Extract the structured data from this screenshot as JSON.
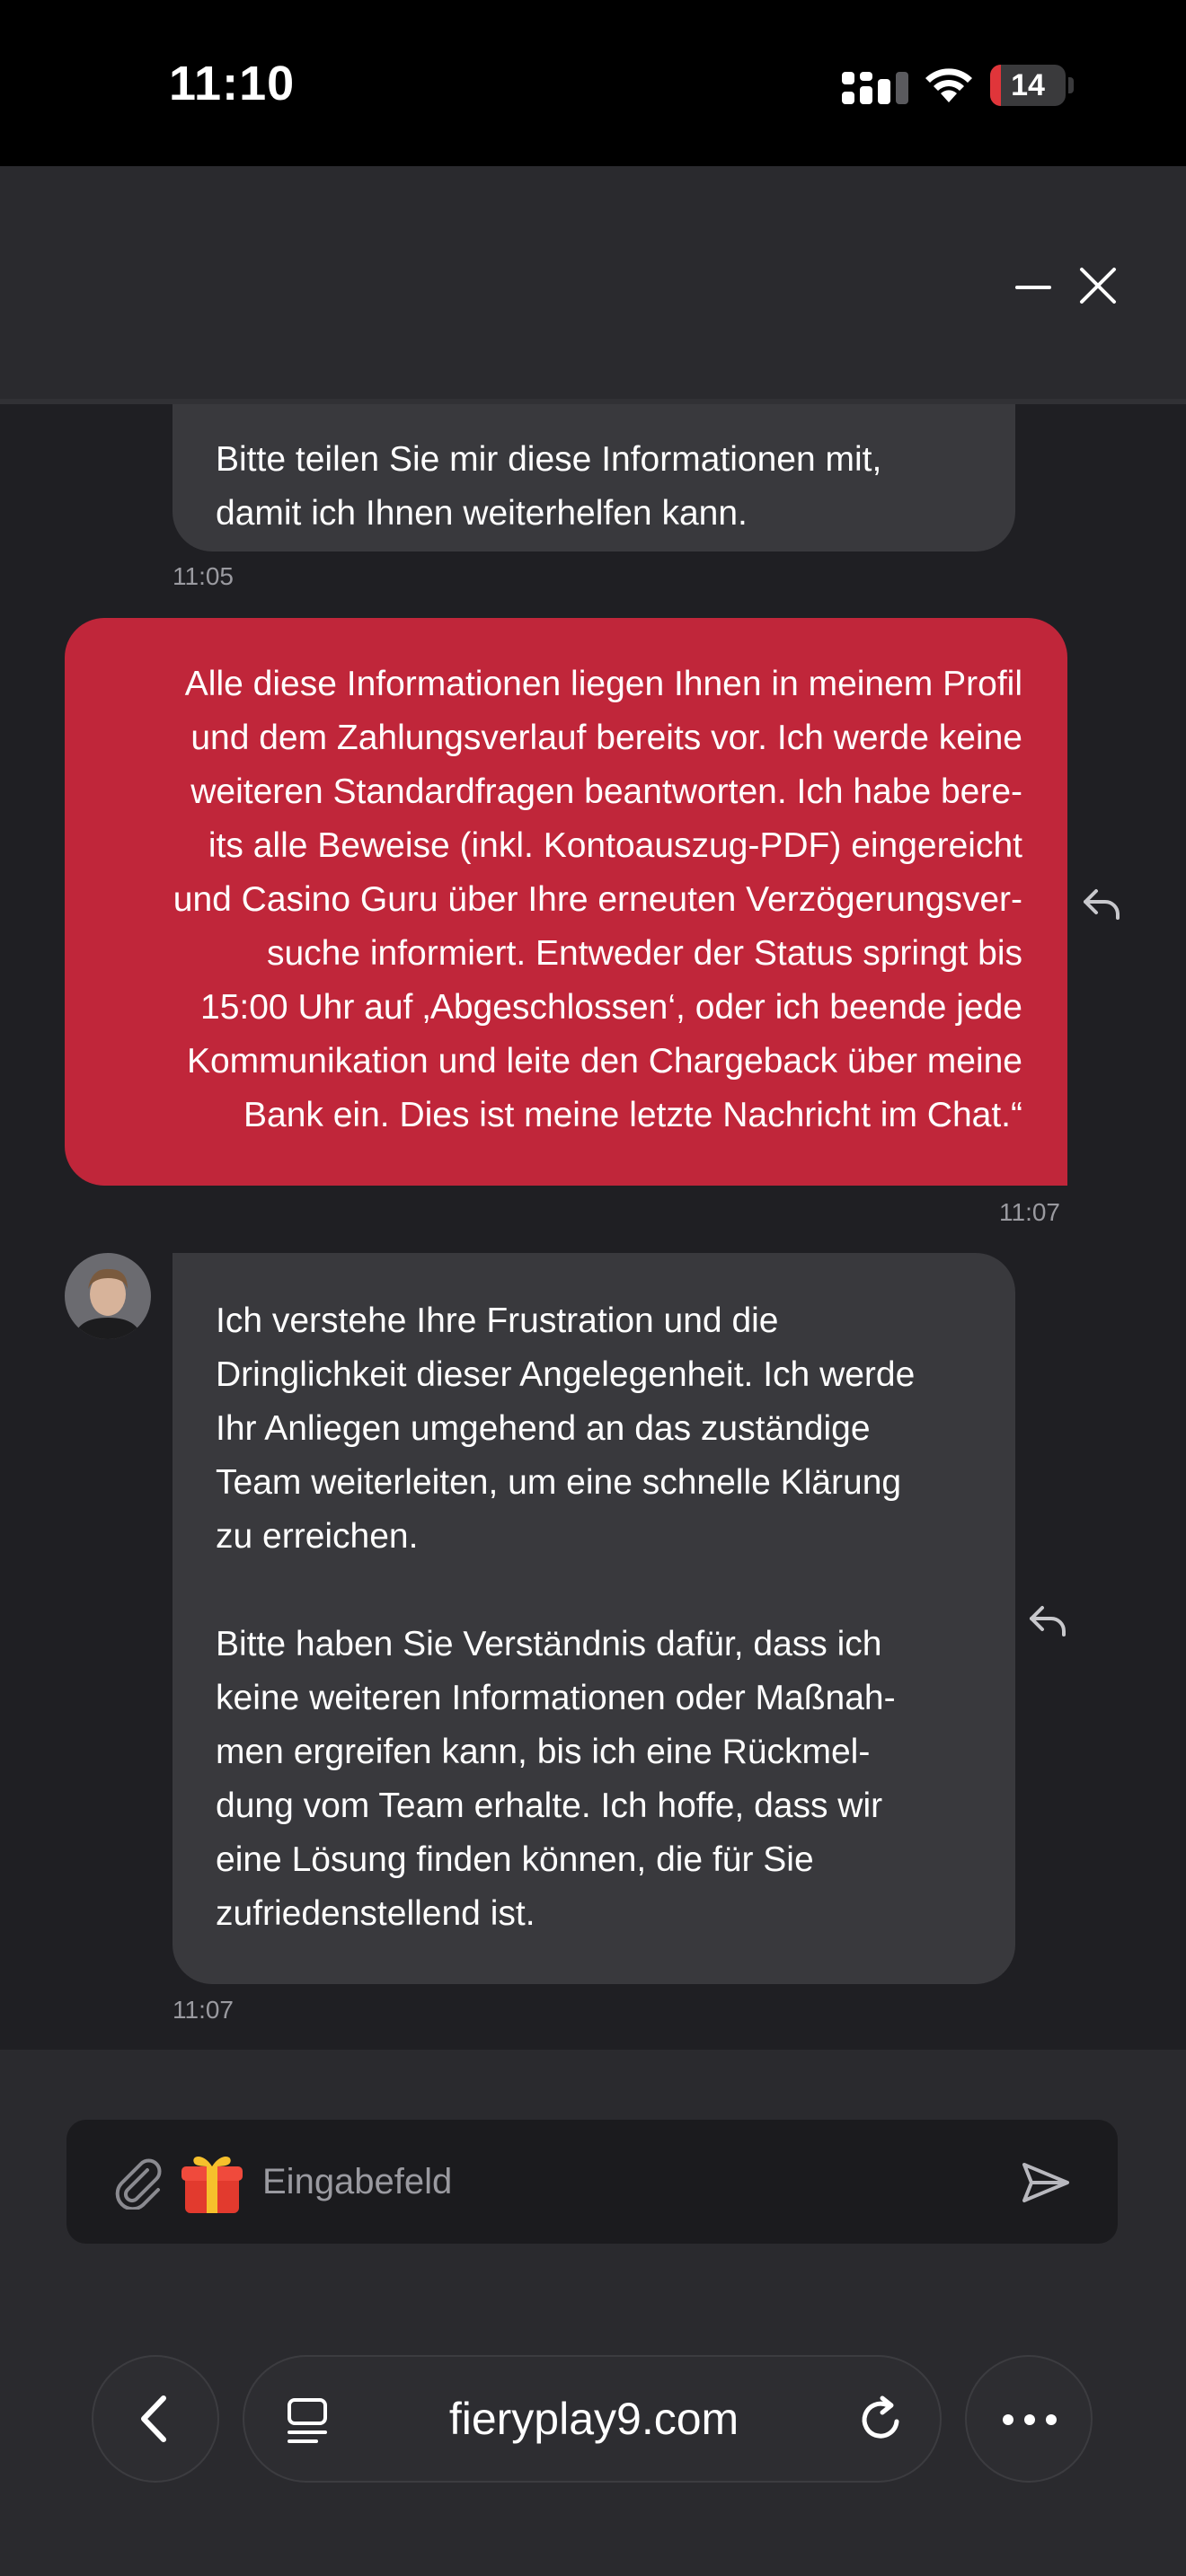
{
  "status_bar": {
    "time": "11:10",
    "battery": "14",
    "battery_level": 0.14
  },
  "messages": [
    {
      "sender": "agent",
      "text": "Bitte teilen Sie mir diese Informationen mit,\ndamit ich Ihnen weiterhelfen kann.",
      "time": "11:05"
    },
    {
      "sender": "user",
      "text": "Alle diese Informationen liegen Ihnen in meinem Profil\nund dem Zahlungsverlauf bereits vor. Ich werde keine\nweiteren Standardfragen beantworten. Ich habe bere-\nits alle Beweise (inkl. Kontoauszug-PDF) eingereicht\nund Casino Guru über Ihre erneuten Verzögerungsver-\nsuche informiert. Entweder der Status springt bis\n15:00 Uhr auf ‚Abgeschlossen‘, oder ich beende jede\nKommunikation und leite den Chargeback über meine\nBank ein. Dies ist meine letzte Nachricht im Chat.“",
      "time": "11:07"
    },
    {
      "sender": "agent",
      "text": "Ich verstehe Ihre Frustration und die\nDringlichkeit dieser Angelegenheit. Ich werde\nIhr Anliegen umgehend an das zuständige\nTeam weiterleiten, um eine schnelle Klärung\nzu erreichen.\n\nBitte haben Sie Verständnis dafür, dass ich\nkeine weiteren Informationen oder Maßnah-\nmen ergreifen kann, bis ich eine Rückmel-\ndung vom Team erhalte. Ich hoffe, dass wir\neine Lösung finden können, die für Sie\nzufriedenstellend ist.",
      "time": "11:07"
    }
  ],
  "composer": {
    "placeholder": "Eingabefeld"
  },
  "browser": {
    "url": "fieryplay9.com"
  },
  "colors": {
    "user_bubble": "#c0263a",
    "agent_bubble": "#39393d",
    "background": "#1f1f23"
  }
}
